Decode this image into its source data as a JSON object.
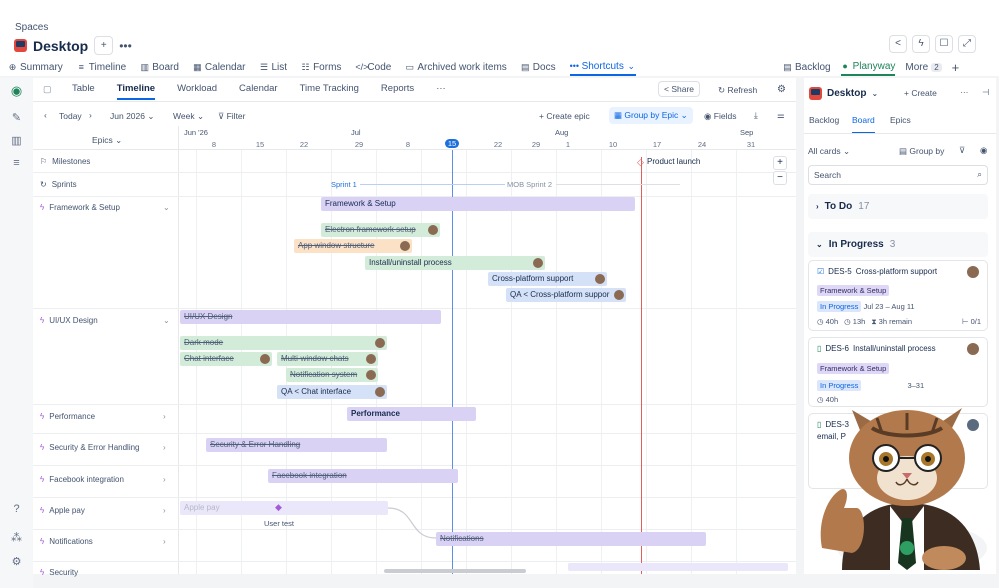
{
  "header": {
    "spaces": "Spaces",
    "title": "Desktop"
  },
  "tabs": [
    {
      "label": "Summary",
      "icon": "globe-icon"
    },
    {
      "label": "Timeline",
      "icon": "timeline-icon"
    },
    {
      "label": "Board",
      "icon": "board-icon"
    },
    {
      "label": "Calendar",
      "icon": "calendar-icon"
    },
    {
      "label": "List",
      "icon": "list-icon"
    },
    {
      "label": "Forms",
      "icon": "forms-icon"
    },
    {
      "label": "Code",
      "icon": "code-icon"
    },
    {
      "label": "Archived work items",
      "icon": "archive-icon"
    },
    {
      "label": "Docs",
      "icon": "docs-icon"
    },
    {
      "label": "Shortcuts",
      "icon": "dots-icon"
    }
  ],
  "right_tabs": {
    "backlog": "Backlog",
    "planyway": "Planyway",
    "more": "More",
    "more_count": "2"
  },
  "view_tabs": [
    "Table",
    "Timeline",
    "Workload",
    "Calendar",
    "Time Tracking",
    "Reports"
  ],
  "toolbar": {
    "share": "Share",
    "refresh": "Refresh",
    "today": "Today",
    "month": "Jun 2026",
    "week": "Week",
    "filter": "Filter",
    "create_epic": "Create epic",
    "group_by": "Group by Epic",
    "fields": "Fields",
    "epics": "Epics"
  },
  "months": [
    "Jun '26",
    "Jul",
    "Aug",
    "Sep"
  ],
  "days": [
    "8",
    "15",
    "22",
    "29",
    "6",
    "8",
    "15",
    "22",
    "29",
    "1",
    "10",
    "17",
    "24",
    "31"
  ],
  "today_day": "15",
  "rows": {
    "milestones": "Milestones",
    "sprints": "Sprints",
    "framework": "Framework & Setup",
    "uiux": "UI/UX Design",
    "performance": "Performance",
    "security": "Security & Error Handling",
    "facebook": "Facebook integration",
    "applepay": "Apple pay",
    "notifications": "Notifications",
    "security2": "Security"
  },
  "timeline": {
    "product_launch": "Product launch",
    "sprint1": "Sprint 1",
    "sprint2": "MOB Sprint 2",
    "framework_epic": "Framework & Setup",
    "electron": "Electron framework setup",
    "appwindow": "App window structure",
    "install": "Install/uninstall process",
    "crossplat": "Cross-platform support",
    "qa_cross": "QA < Cross-platform suppor",
    "uiux_epic": "UI/UX Design",
    "darkmode": "Dark mode",
    "chat": "Chat interface",
    "multiwin": "Multi-window chats",
    "notifsys": "Notification system",
    "qa_chat": "QA < Chat interface",
    "perf_epic": "Performance",
    "sec_epic": "Security & Error Handling",
    "fb_epic": "Facebook integration",
    "apple_epic": "Apple pay",
    "usertest": "User test",
    "notif_epic": "Notifications"
  },
  "panel": {
    "title": "Desktop",
    "create": "Create",
    "tabs": [
      "Backlog",
      "Board",
      "Epics"
    ],
    "all_cards": "All cards",
    "group_by": "Group by",
    "search": "Search",
    "todo": "To Do",
    "todo_count": "17",
    "inprogress": "In Progress",
    "inprogress_count": "3",
    "cards": [
      {
        "key": "DES-5",
        "title": "Cross-platform support",
        "label": "Framework & Setup",
        "status": "In Progress",
        "dates": "Jul 23 – Aug 11",
        "est": "40h",
        "spent": "13h",
        "remain": "3h remain",
        "sub": "0/1"
      },
      {
        "key": "DES-6",
        "title": "Install/uninstall process",
        "label": "Framework & Setup",
        "status": "In Progress",
        "dates": "3–31",
        "est": "40h"
      },
      {
        "key": "DES-3",
        "title": "email, P"
      }
    ]
  }
}
